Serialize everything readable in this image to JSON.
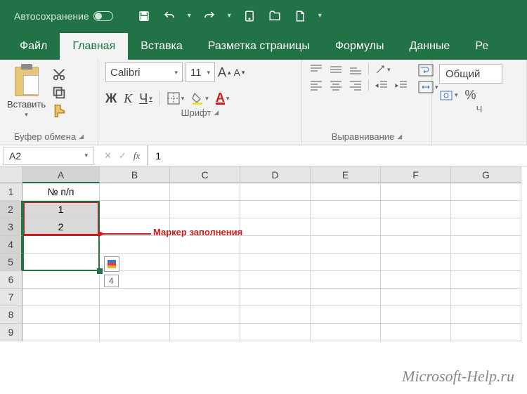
{
  "titlebar": {
    "autosave": "Автосохранение"
  },
  "tabs": {
    "file": "Файл",
    "home": "Главная",
    "insert": "Вставка",
    "layout": "Разметка страницы",
    "formulas": "Формулы",
    "data": "Данные",
    "review": "Ре"
  },
  "ribbon": {
    "clipboard": {
      "paste": "Вставить",
      "label": "Буфер обмена"
    },
    "font": {
      "name": "Calibri",
      "size": "11",
      "bold": "Ж",
      "italic": "К",
      "underline": "Ч",
      "bigA": "А",
      "smallA": "А",
      "label": "Шрифт"
    },
    "alignment": {
      "label": "Выравнивание"
    },
    "number": {
      "format": "Общий",
      "pct": "%",
      "label": "Ч"
    }
  },
  "formula_bar": {
    "namebox": "A2",
    "value": "1"
  },
  "grid": {
    "cols": [
      "A",
      "B",
      "C",
      "D",
      "E",
      "F",
      "G"
    ],
    "rows": [
      "1",
      "2",
      "3",
      "4",
      "5",
      "6",
      "7",
      "8",
      "9"
    ],
    "cells": {
      "A1": "№ п/п",
      "A2": "1",
      "A3": "2"
    },
    "tooltip": "4"
  },
  "annotation": {
    "text": "Маркер заполнения"
  },
  "watermark": "Microsoft-Help.ru"
}
